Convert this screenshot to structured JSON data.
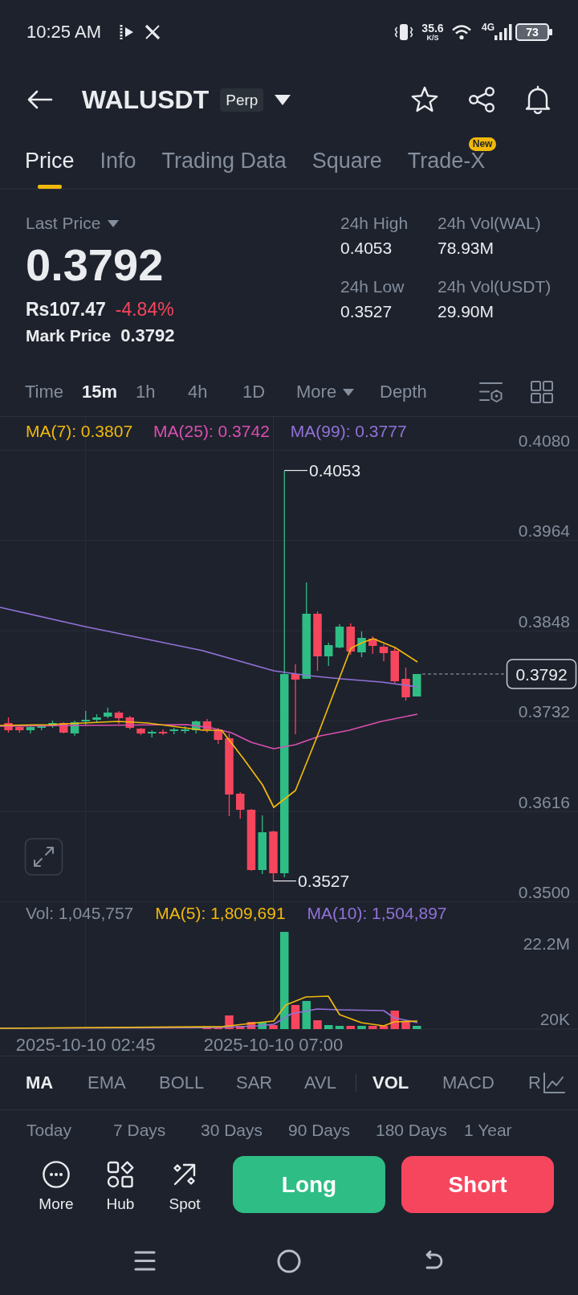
{
  "status_bar": {
    "time": "10:25 AM",
    "speed": "35.6",
    "speed_unit": "K/S",
    "network": "4G",
    "battery": "73"
  },
  "header": {
    "symbol": "WALUSDT",
    "contract": "Perp"
  },
  "tabs": [
    {
      "label": "Price",
      "selected": true
    },
    {
      "label": "Info",
      "selected": false
    },
    {
      "label": "Trading Data",
      "selected": false
    },
    {
      "label": "Square",
      "selected": false
    },
    {
      "label": "Trade-X",
      "selected": false,
      "badge": "New"
    }
  ],
  "ticker": {
    "last_price_label": "Last Price",
    "last_price": "0.3792",
    "fiat_price": "Rs107.47",
    "change": "-4.84%",
    "mark_price_label": "Mark Price",
    "mark_price": "0.3792",
    "stats": [
      {
        "label": "24h High",
        "value": "0.4053"
      },
      {
        "label": "24h Vol(WAL)",
        "value": "78.93M"
      },
      {
        "label": "24h Low",
        "value": "0.3527"
      },
      {
        "label": "24h Vol(USDT)",
        "value": "29.90M"
      }
    ]
  },
  "intervals": [
    {
      "label": "Time",
      "kind": "option",
      "selected": false
    },
    {
      "label": "15m",
      "kind": "option",
      "selected": true
    },
    {
      "label": "1h",
      "kind": "option",
      "selected": false
    },
    {
      "label": "4h",
      "kind": "option",
      "selected": false
    },
    {
      "label": "1D",
      "kind": "option",
      "selected": false
    },
    {
      "label": "More",
      "kind": "dropdown",
      "selected": false
    },
    {
      "label": "Depth",
      "kind": "option",
      "selected": false
    }
  ],
  "chart": {
    "ma_legend": [
      {
        "text": "MA(7): 0.3807",
        "color": "#f0b90b"
      },
      {
        "text": "MA(25): 0.3742",
        "color": "#d94fb0"
      },
      {
        "text": "MA(99): 0.3777",
        "color": "#9172d8"
      }
    ],
    "price_axis": [
      "0.4080",
      "0.3964",
      "0.3848",
      "0.3732",
      "0.3616",
      "0.3500"
    ],
    "high_label": "0.4053",
    "low_label": "0.3527",
    "current_price": "0.3792",
    "volume_legend": [
      {
        "text": "Vol: 1,045,757",
        "color": "#848e9c"
      },
      {
        "text": "MA(5): 1,809,691",
        "color": "#f0b90b"
      },
      {
        "text": "MA(10): 1,504,897",
        "color": "#9172d8"
      }
    ],
    "volume_axis": [
      "22.2M",
      "20K"
    ],
    "time_axis": [
      "2025-10-10 02:45",
      "2025-10-10 07:00"
    ]
  },
  "main_indicators": [
    {
      "label": "MA",
      "selected": true
    },
    {
      "label": "EMA",
      "selected": false
    },
    {
      "label": "BOLL",
      "selected": false
    },
    {
      "label": "SAR",
      "selected": false
    },
    {
      "label": "AVL",
      "selected": false
    }
  ],
  "sub_indicators": [
    {
      "label": "VOL",
      "selected": true
    },
    {
      "label": "MACD",
      "selected": false
    },
    {
      "label": "R",
      "selected": false
    }
  ],
  "performance_periods": [
    "Today",
    "7 Days",
    "30 Days",
    "90 Days",
    "180 Days",
    "1 Year"
  ],
  "toolbar": [
    {
      "label": "More",
      "kind": "more"
    },
    {
      "label": "Hub",
      "kind": "hub"
    },
    {
      "label": "Spot",
      "kind": "spot"
    }
  ],
  "trade_buttons": [
    {
      "label": "Long",
      "kind": "long"
    },
    {
      "label": "Short",
      "kind": "short"
    }
  ]
}
